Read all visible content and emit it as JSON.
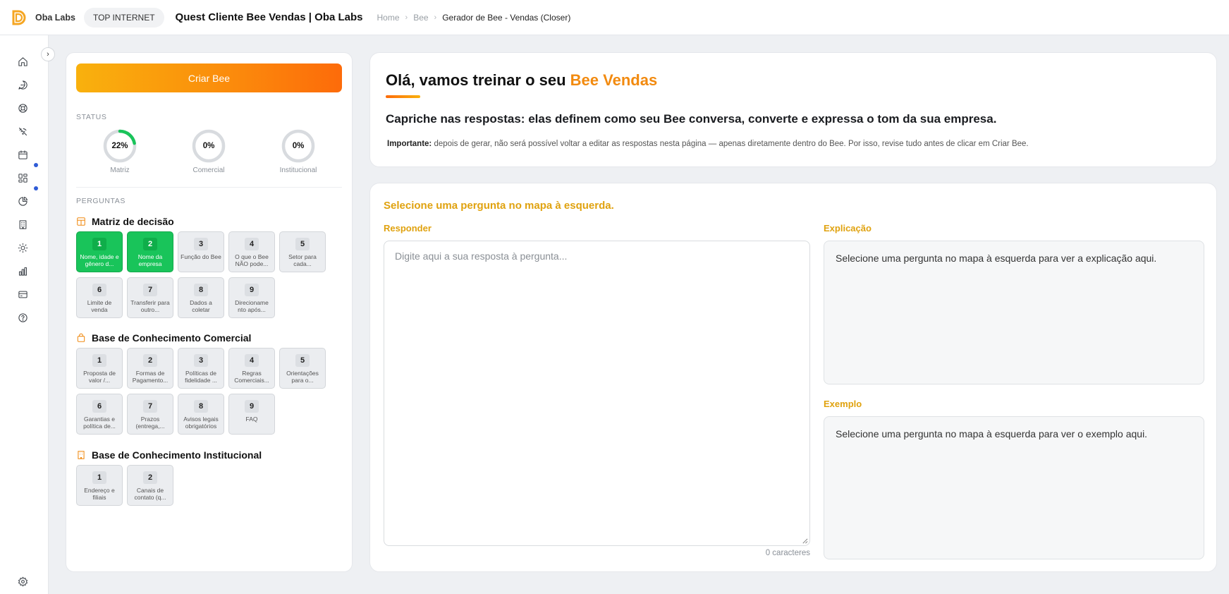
{
  "topbar": {
    "org_name": "Oba Labs",
    "workspace": "TOP INTERNET",
    "title": "Quest Cliente Bee Vendas | Oba Labs",
    "breadcrumb": [
      "Home",
      "Bee",
      "Gerador de Bee - Vendas (Closer)"
    ]
  },
  "sidebar": {
    "items": [
      {
        "icon": "home-icon"
      },
      {
        "icon": "chat-icon"
      },
      {
        "icon": "lifebuoy-icon"
      },
      {
        "icon": "signal-off-icon"
      },
      {
        "icon": "calendar-icon"
      },
      {
        "icon": "dashboard-icon",
        "badge": true
      },
      {
        "icon": "pie-chart-icon",
        "badge": true
      },
      {
        "icon": "building-icon"
      },
      {
        "icon": "sun-icon"
      },
      {
        "icon": "bar-chart-icon"
      },
      {
        "icon": "credit-card-icon"
      },
      {
        "icon": "help-icon"
      }
    ],
    "bottom_icon": "settings-icon",
    "badge_color": "#2f5bd6"
  },
  "left_panel": {
    "create_button": "Criar Bee",
    "status_label": "STATUS",
    "status": [
      {
        "label": "Matriz",
        "value": "22%",
        "percent": 22
      },
      {
        "label": "Comercial",
        "value": "0%",
        "percent": 0
      },
      {
        "label": "Institucional",
        "value": "0%",
        "percent": 0
      }
    ],
    "questions_label": "PERGUNTAS",
    "groups": [
      {
        "title": "Matriz de decisão",
        "icon": "layout-icon",
        "questions": [
          {
            "num": "1",
            "text": "Nome, idade e gênero d...",
            "done": true
          },
          {
            "num": "2",
            "text": "Nome da empresa",
            "done": true
          },
          {
            "num": "3",
            "text": "Função do Bee",
            "done": false
          },
          {
            "num": "4",
            "text": "O que o Bee NÃO pode...",
            "done": false
          },
          {
            "num": "5",
            "text": "Setor para cada...",
            "done": false
          },
          {
            "num": "6",
            "text": "Limite de venda",
            "done": false
          },
          {
            "num": "7",
            "text": "Transferir para outro...",
            "done": false
          },
          {
            "num": "8",
            "text": "Dados a coletar",
            "done": false
          },
          {
            "num": "9",
            "text": "Direcioname nto após...",
            "done": false
          }
        ]
      },
      {
        "title": "Base de Conhecimento Comercial",
        "icon": "bag-icon",
        "questions": [
          {
            "num": "1",
            "text": "Proposta de valor /...",
            "done": false
          },
          {
            "num": "2",
            "text": "Formas de Pagamento...",
            "done": false
          },
          {
            "num": "3",
            "text": "Políticas de fidelidade ...",
            "done": false
          },
          {
            "num": "4",
            "text": "Regras Comerciais...",
            "done": false
          },
          {
            "num": "5",
            "text": "Orientações para o...",
            "done": false
          },
          {
            "num": "6",
            "text": "Garantias e política de...",
            "done": false
          },
          {
            "num": "7",
            "text": "Prazos (entrega,...",
            "done": false
          },
          {
            "num": "8",
            "text": "Avisos legais obrigatórios",
            "done": false
          },
          {
            "num": "9",
            "text": "FAQ",
            "done": false
          }
        ]
      },
      {
        "title": "Base de Conhecimento Institucional",
        "icon": "building-icon",
        "questions": [
          {
            "num": "1",
            "text": "Endereço e filiais",
            "done": false
          },
          {
            "num": "2",
            "text": "Canais de contato (q...",
            "done": false
          }
        ]
      }
    ]
  },
  "intro": {
    "title_prefix": "Olá, vamos treinar o seu ",
    "title_brand": "Bee Vendas",
    "subtitle": "Capriche nas respostas: elas definem como seu Bee conversa, converte e expressa o tom da sua empresa.",
    "note_bold": "Importante:",
    "note_text": " depois de gerar, não será possível voltar a editar as respostas nesta página — apenas diretamente dentro do Bee. Por isso, revise tudo antes de clicar em Criar Bee."
  },
  "main": {
    "select_prompt": "Selecione uma pergunta no mapa à esquerda.",
    "answer_label": "Responder",
    "answer_value": "",
    "answer_placeholder": "Digite aqui a sua resposta à pergunta...",
    "char_count": "0 caracteres",
    "explanation_label": "Explicação",
    "explanation_text": "Selecione uma pergunta no mapa à esquerda para ver a explicação aqui.",
    "example_label": "Exemplo",
    "example_text": "Selecione uma pergunta no mapa à esquerda para ver o exemplo aqui."
  },
  "colors": {
    "accent_orange": "#f28a0f",
    "accent_gold": "#e0a20f",
    "done_green": "#19c45a",
    "ring_done": "#19c45a",
    "ring_track": "#d8dbdf"
  }
}
